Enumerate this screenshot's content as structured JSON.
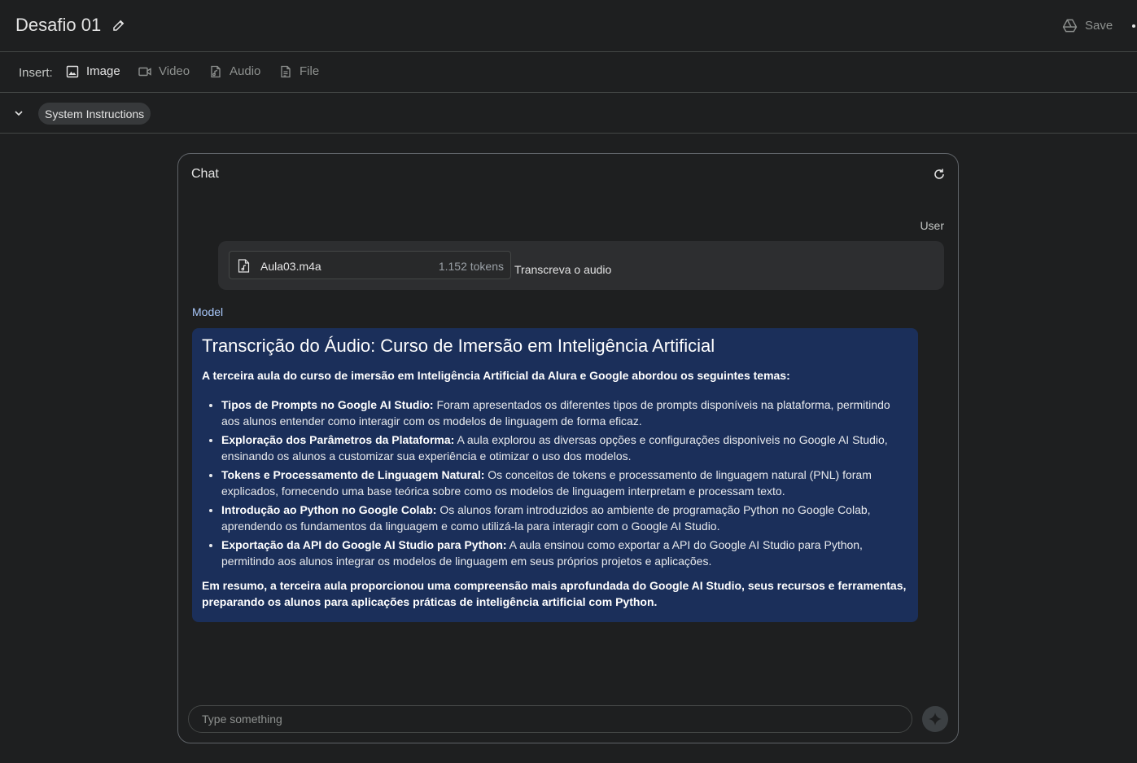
{
  "header": {
    "title": "Desafio 01",
    "save_label": "Save"
  },
  "insert_bar": {
    "label": "Insert:",
    "items": [
      {
        "label": "Image",
        "icon": "image-icon",
        "active": true
      },
      {
        "label": "Video",
        "icon": "video-icon",
        "active": false
      },
      {
        "label": "Audio",
        "icon": "audio-file-icon",
        "active": false
      },
      {
        "label": "File",
        "icon": "file-icon",
        "active": false
      }
    ]
  },
  "system_instructions": {
    "label": "System Instructions"
  },
  "chat": {
    "title": "Chat",
    "user_role": "User",
    "attachment": {
      "name": "Aula03.m4a",
      "tokens": "1.152 tokens"
    },
    "user_message": "Transcreva o audio",
    "model_role": "Model",
    "model": {
      "heading": "Transcrição do Áudio: Curso de Imersão em Inteligência Artificial",
      "intro": "A terceira aula do curso de imersão em Inteligência Artificial da Alura e Google abordou os seguintes temas:",
      "items": [
        {
          "bold": "Tipos de Prompts no Google AI Studio:",
          "text": " Foram apresentados os diferentes tipos de prompts disponíveis na plataforma, permitindo aos alunos entender como interagir com os modelos de linguagem de forma eficaz."
        },
        {
          "bold": "Exploração dos Parâmetros da Plataforma:",
          "text": " A aula explorou as diversas opções e configurações disponíveis no Google AI Studio, ensinando os alunos a customizar sua experiência e otimizar o uso dos modelos."
        },
        {
          "bold": "Tokens e Processamento de Linguagem Natural:",
          "text": " Os conceitos de tokens e processamento de linguagem natural (PNL) foram explicados, fornecendo uma base teórica sobre como os modelos de linguagem interpretam e processam texto."
        },
        {
          "bold": "Introdução ao Python no Google Colab:",
          "text": " Os alunos foram introduzidos ao ambiente de programação Python no Google Colab, aprendendo os fundamentos da linguagem e como utilizá-la para interagir com o Google AI Studio."
        },
        {
          "bold": "Exportação da API do Google AI Studio para Python:",
          "text": " A aula ensinou como exportar a API do Google AI Studio para Python, permitindo aos alunos integrar os modelos de linguagem em seus próprios projetos e aplicações."
        }
      ],
      "summary": "Em resumo, a terceira aula proporcionou uma compreensão mais aprofundada do Google AI Studio, seus recursos e ferramentas, preparando os alunos para aplicações práticas de inteligência artificial com Python."
    },
    "input": {
      "placeholder": "Type something",
      "value": ""
    }
  }
}
